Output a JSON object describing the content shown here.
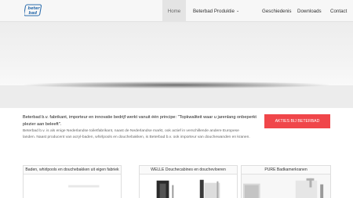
{
  "brand": {
    "logo_text": "beter bad",
    "accent": "#2f6fae"
  },
  "nav": {
    "items": [
      {
        "label": "Home",
        "active": true
      },
      {
        "label": "Beterbad Produktie",
        "dropdown": true
      },
      {
        "label": "Geschiedenis"
      },
      {
        "label": "Downloads"
      },
      {
        "label": "Contact"
      }
    ],
    "dropdown_icon": "chevron-down-icon"
  },
  "intro": {
    "lead": "Beterbad b.v. fabrikant, importeur en innovatie bedrijf werkt vanuit één principe: \"Topkwaliteit waar u jarenlang onbeperkt plezier aan beleeft\".",
    "body": "Beterbad b.v. is als enige Nederlandse toiletfabrikant, naast de Nederlandse markt, ook actief in verschillende andere Europese landen. Naast producent van acryl-baden, whirlpools en douchebakken, is Beterbad b.v. ook importeur van douchewanden en kranen."
  },
  "cta": {
    "label": "AKTIES BIJ BETERBAD",
    "color": "#f0464a"
  },
  "cards": [
    {
      "title": "Baden, whirlpools en douchebakken uit eigen fabriek"
    },
    {
      "title": "WELLE Douchecabines en douchevloeren"
    },
    {
      "title": "PURE Badkamerkranen"
    }
  ]
}
